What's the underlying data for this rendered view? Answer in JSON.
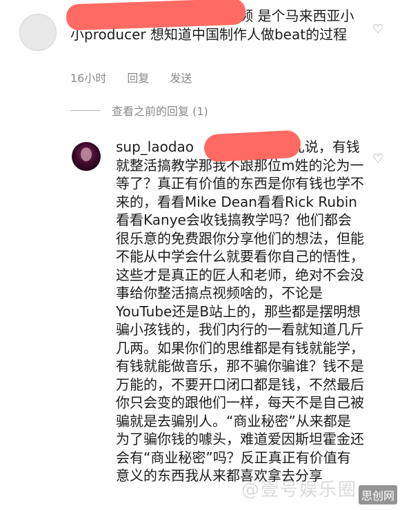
{
  "comment1": {
    "text": "道姐几时可以拍个做beat视频 是个马来西亚小小producer 想知道中国制作人做beat的过程",
    "time": "16小时",
    "reply": "回复",
    "send": "发送"
  },
  "view_replies": "查看之前的回复 (1)",
  "comment2": {
    "username": "sup_laodao",
    "text_pre": "h 别乱说，有钱就整活搞教学那我不跟那位m姓的沦为一等了？真正有价值的东西是你有钱也学不来的，看看Mike Dean看看Rick Rubin看看Kanye会收钱搞教学吗？他们都会很乐意的免费跟你分享他们的想法，但能不能从中学会什么就要看你自己的悟性，这些才是真正的匠人和老师，绝对不会没事给你整活搞点视频啥的，不论是YouTube还是B站上的，那些都是摆明想骗小孩钱的，我们内行的一看就知道几斤几两。如果你们的思维都是有钱就能学，有钱就能做音乐，那不骗你骗谁？钱不是万能的，不要开口闭口都是钱，不然最后你只会变的跟他们一样，每天不是自己被骗就是去骗别人。“商业秘密”从来都是为了骗你钱的噱头，难道爱因斯坦霍金还会有“商业秘密”吗？反正真正有价值有意义的东西我从来都喜欢拿去分享"
  },
  "watermark": "@壹号娱乐圈",
  "watermark_badge": "思创网",
  "colors": {
    "redaction": "#ff6b63",
    "meta": "#8a8a8a"
  }
}
